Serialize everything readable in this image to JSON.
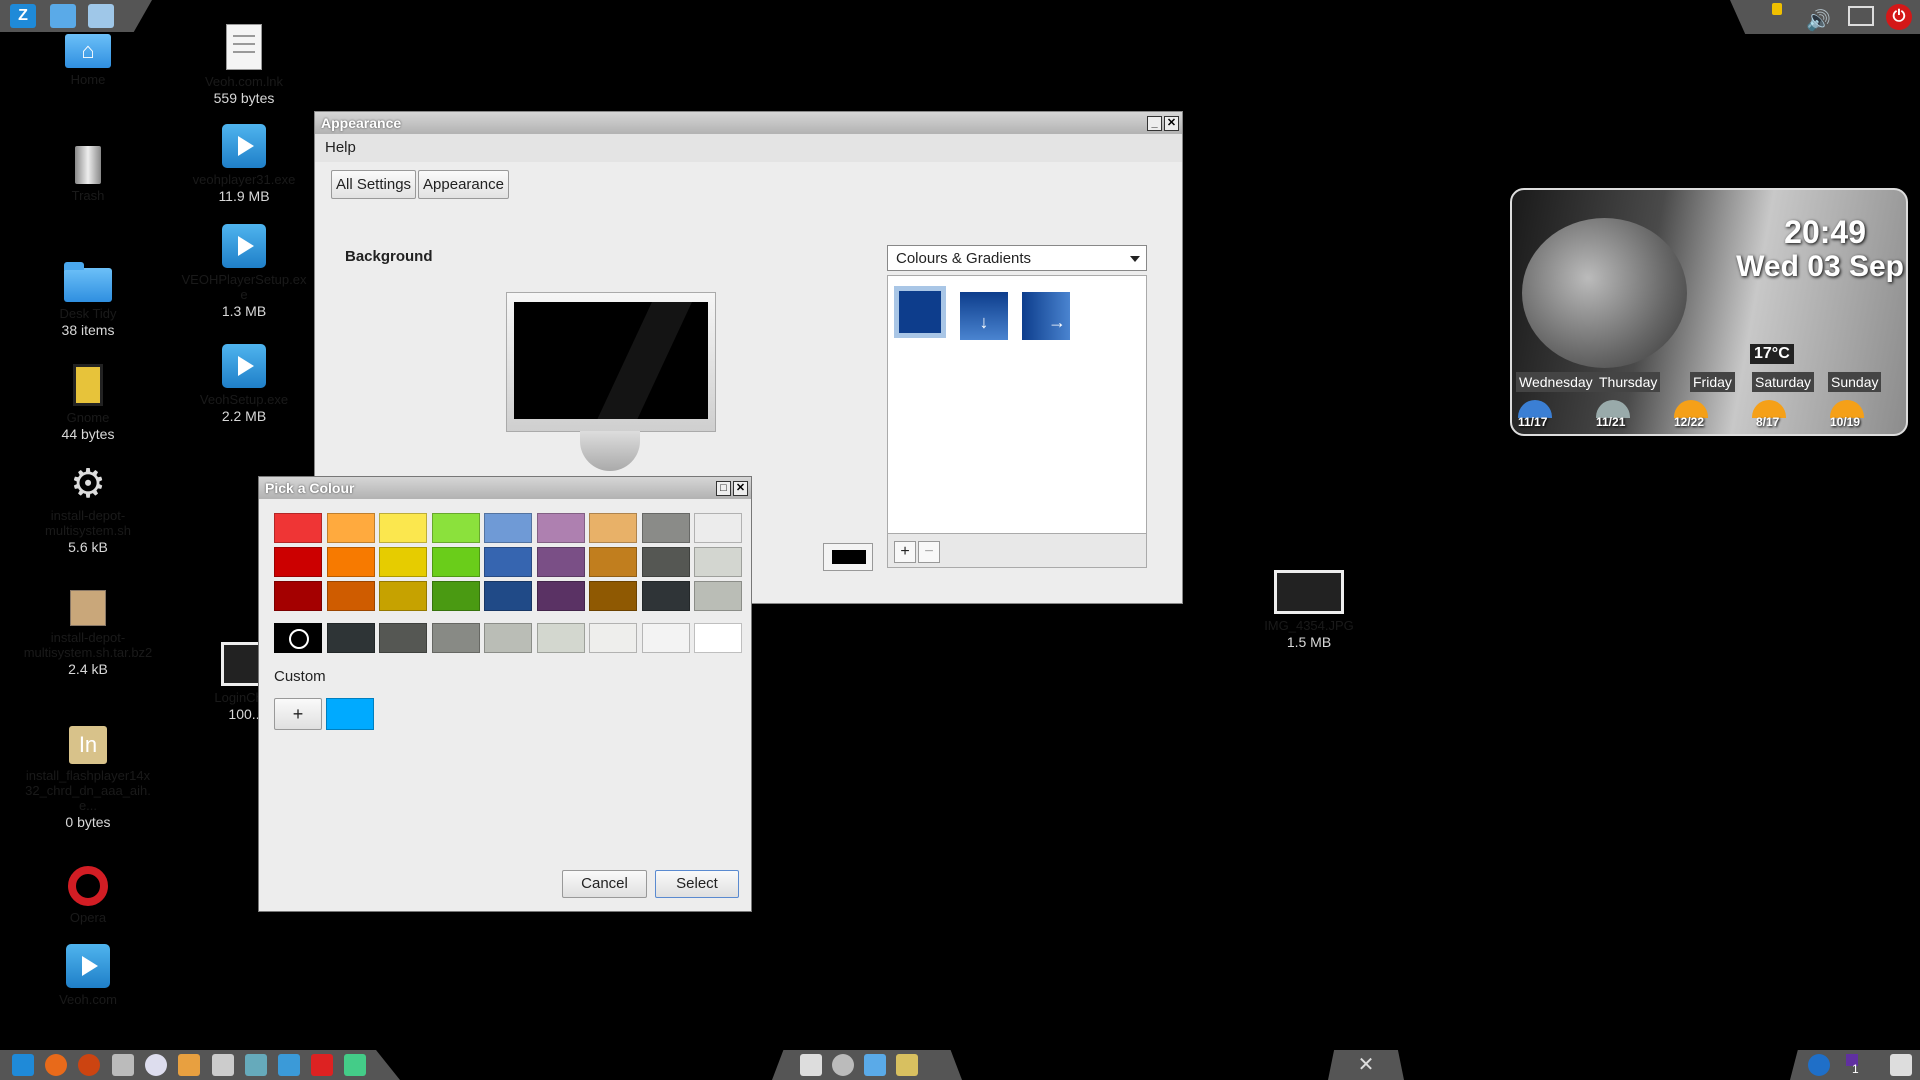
{
  "desktop": {
    "col1": [
      {
        "name": "Home",
        "size": ""
      },
      {
        "name": "Trash",
        "size": ""
      },
      {
        "name": "Desk Tidy",
        "size": "38 items"
      },
      {
        "name": "Gnome",
        "size": "44 bytes"
      },
      {
        "name": "install-depot-multisystem.sh",
        "size": "5.6 kB"
      },
      {
        "name": "install-depot-multisystem.sh.tar.bz2",
        "size": "2.4 kB"
      },
      {
        "name": "install_flashplayer14x32_chrd_dn_aaa_aih.e...",
        "size": "0 bytes"
      },
      {
        "name": "Opera",
        "size": ""
      },
      {
        "name": "Veoh.com",
        "size": ""
      }
    ],
    "col2": [
      {
        "name": "Veoh.com.lnk",
        "size": "559 bytes"
      },
      {
        "name": "veohplayer31.exe",
        "size": "11.9 MB"
      },
      {
        "name": "VEOHPlayerSetup.exe",
        "size": "1.3 MB"
      },
      {
        "name": "VeohSetup.exe",
        "size": "2.2 MB"
      },
      {
        "name": "LoginCh...",
        "size": "100.."
      }
    ],
    "img": {
      "name": "IMG_4354.JPG",
      "size": "1.5 MB"
    }
  },
  "appearance": {
    "title": "Appearance",
    "menu": {
      "help": "Help"
    },
    "crumbs": [
      "All Settings",
      "Appearance"
    ],
    "background_label": "Background",
    "mode": "Colours & Gradients",
    "gradient_colors": [
      "#0d3d8c",
      "#2a64b8"
    ],
    "color_value": "#000000"
  },
  "picker": {
    "title": "Pick a Colour",
    "palette": [
      [
        "#ef3535",
        "#ffaa3e",
        "#fbe74e",
        "#8be13c",
        "#6f9ad6",
        "#ae80b0",
        "#e8b168",
        "#8a8b88",
        "#ececec"
      ],
      [
        "#cc0000",
        "#f77a00",
        "#e6cc00",
        "#6acd1a",
        "#3665b0",
        "#7a4f86",
        "#c17e1e",
        "#555753",
        "#d3d6d0"
      ],
      [
        "#a40000",
        "#cf5c00",
        "#c6a200",
        "#4a9a12",
        "#204a87",
        "#5a3264",
        "#8f5902",
        "#2f3437",
        "#babdb6"
      ]
    ],
    "grays": [
      "#000000",
      "#2e3436",
      "#555753",
      "#888a85",
      "#babdb6",
      "#d3d7cf",
      "#eeeeec",
      "#f3f3f3",
      "#ffffff"
    ],
    "custom_label": "Custom",
    "custom_add": "+",
    "custom_color": "#00aaff",
    "cancel": "Cancel",
    "select": "Select"
  },
  "weather": {
    "time": "20:49",
    "date": "Wed 03 Sep",
    "temp": "17°C",
    "days": [
      {
        "day": "Wednesday",
        "temps": "11/17"
      },
      {
        "day": "Thursday",
        "temps": "11/21"
      },
      {
        "day": "Friday",
        "temps": "12/22"
      },
      {
        "day": "Saturday",
        "temps": "8/17"
      },
      {
        "day": "Sunday",
        "temps": "10/19"
      }
    ]
  },
  "tray": {
    "workspace": "1"
  }
}
